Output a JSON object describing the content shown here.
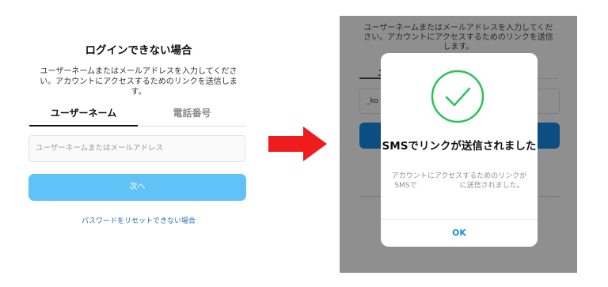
{
  "left": {
    "title": "ログインできない場合",
    "description": "ユーザーネームまたはメールアドレスを入力してください。アカウントにアクセスするためのリンクを送信します。",
    "tabs": [
      {
        "label": "ユーザーネーム",
        "active": true
      },
      {
        "label": "電話番号",
        "active": false
      }
    ],
    "input_placeholder": "ユーザーネームまたはメールアドレス",
    "next_button": "次へ",
    "reset_link": "パスワードをリセットできない場合"
  },
  "right": {
    "background_description": "ユーザーネームまたはメールアドレスを入力してください。アカウントにアクセスするためのリンクを送信します。",
    "background_tab": "ユ",
    "background_input_value": "_ko",
    "modal": {
      "icon": "check-circle-icon",
      "title": "SMSでリンクが送信されました",
      "body": "アカウントにアクセスするためのリンクがSMSで　　　　　　に送信されました。",
      "ok_button": "OK"
    }
  },
  "colors": {
    "primary_button": "#61c2f7",
    "link": "#2a6cb5",
    "arrow": "#ee1c1c",
    "check": "#2ec15a",
    "ok": "#1e8ee8"
  }
}
